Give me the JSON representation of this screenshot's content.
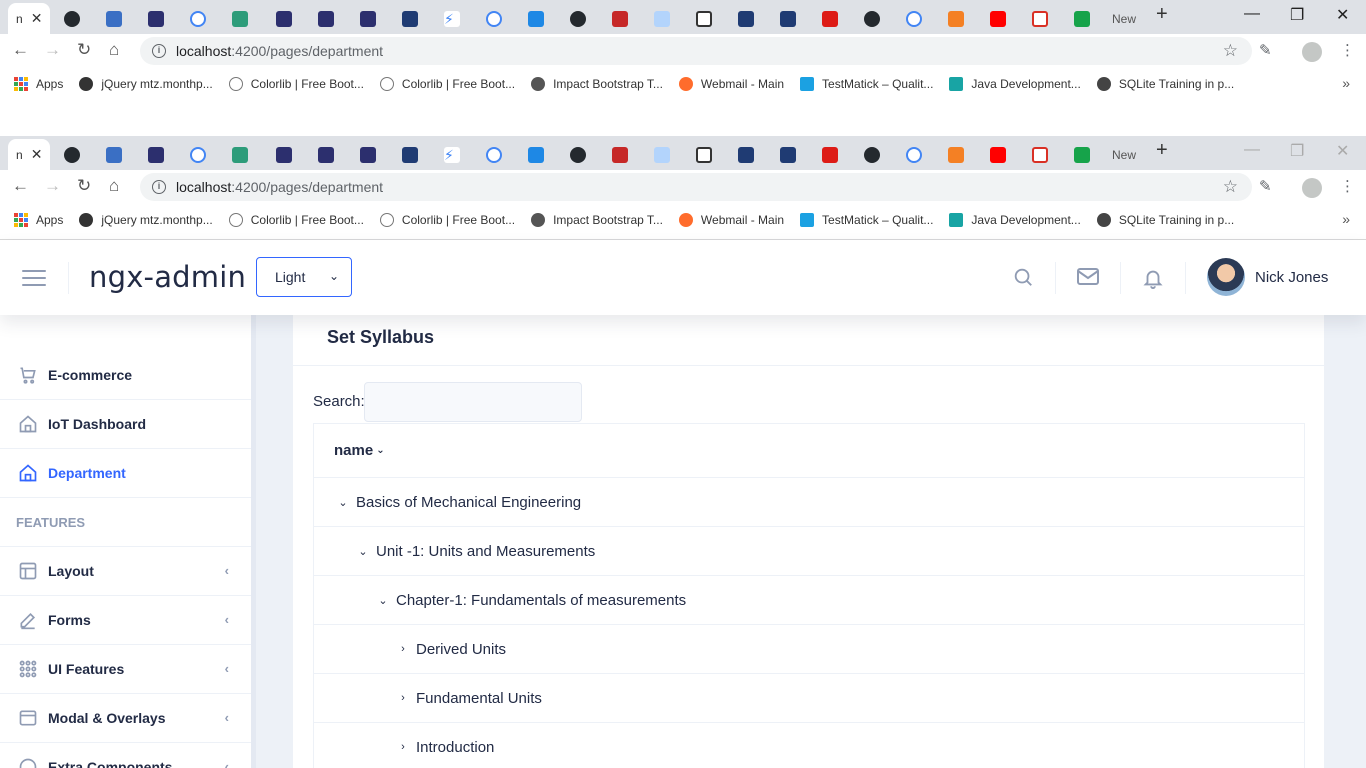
{
  "browser": {
    "active_tab_label": "n",
    "new_tab_label": "New",
    "url_host": "localhost",
    "url_path": ":4200/pages/department",
    "bookmarks": [
      {
        "label": "Apps",
        "color": "#4285f4"
      },
      {
        "label": "jQuery mtz.monthp...",
        "color": "#333333"
      },
      {
        "label": "Colorlib | Free Boot...",
        "color": "#777777"
      },
      {
        "label": "Colorlib | Free Boot...",
        "color": "#777777"
      },
      {
        "label": "Impact Bootstrap T...",
        "color": "#555555"
      },
      {
        "label": "Webmail - Main",
        "color": "#ff6c2c"
      },
      {
        "label": "TestMatick – Qualit...",
        "color": "#1ba1e2"
      },
      {
        "label": "Java Development...",
        "color": "#18a4a4"
      },
      {
        "label": "SQLite Training in p...",
        "color": "#444444"
      }
    ]
  },
  "header": {
    "logo": "ngx-admin",
    "theme": "Light",
    "user_name": "Nick Jones"
  },
  "sidebar": {
    "items": [
      {
        "label": "E-commerce",
        "icon": "shopping-cart-icon"
      },
      {
        "label": "IoT Dashboard",
        "icon": "home-icon"
      },
      {
        "label": "Department",
        "icon": "home-icon"
      }
    ],
    "group_label": "FEATURES",
    "feature_items": [
      {
        "label": "Layout",
        "icon": "layout-icon"
      },
      {
        "label": "Forms",
        "icon": "edit-icon"
      },
      {
        "label": "UI Features",
        "icon": "keypad-icon"
      },
      {
        "label": "Modal & Overlays",
        "icon": "browser-icon"
      },
      {
        "label": "Extra Components",
        "icon": "message-circle-icon"
      }
    ]
  },
  "card": {
    "title": "Set Syllabus",
    "search_label": "Search:",
    "search_value": "",
    "column_header": "name",
    "rows": [
      {
        "label": "Basics of Mechanical Engineering",
        "expanded": true
      },
      {
        "label": "Unit -1: Units and Measurements",
        "expanded": true
      },
      {
        "label": "Chapter-1: Fundamentals of measurements",
        "expanded": true
      },
      {
        "label": "Derived Units",
        "expanded": false
      },
      {
        "label": "Fundamental Units",
        "expanded": false
      },
      {
        "label": "Introduction",
        "expanded": false
      }
    ]
  },
  "colors": {
    "primary": "#3366ff",
    "text": "#222b45",
    "hint": "#8f9bb3",
    "background": "#edf1f7"
  }
}
